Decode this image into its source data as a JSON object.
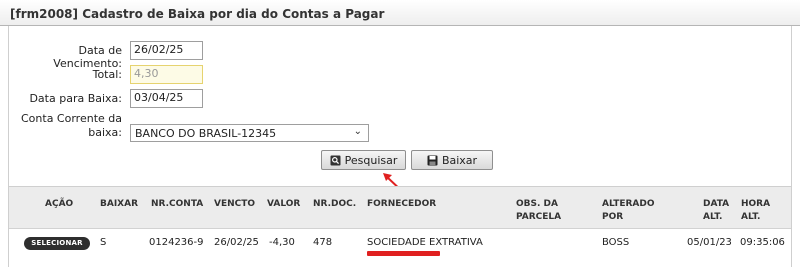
{
  "window": {
    "title": "[frm2008] Cadastro de Baixa por dia do Contas a Pagar"
  },
  "form": {
    "vencimento_label": "Data de Vencimento:",
    "vencimento_value": "26/02/25",
    "total_label": "Total:",
    "total_value": "4,30",
    "baixa_label": "Data para Baixa:",
    "baixa_value": "03/04/25",
    "conta_label_line1": "Conta Corrente da",
    "conta_label_line2": "baixa:",
    "conta_value": "BANCO DO BRASIL-12345"
  },
  "toolbar": {
    "pesquisar_label": "Pesquisar",
    "baixar_label": "Baixar",
    "pesquisar_icon": "search-icon",
    "baixar_icon": "floppy-disk-icon"
  },
  "table": {
    "headers": {
      "acao": "AÇÃO",
      "baixar": "BAIXAR",
      "nr_conta": "NR.CONTA",
      "vencto": "VENCTO",
      "valor": "VALOR",
      "nr_doc": "NR.DOC.",
      "fornecedor": "FORNECEDOR",
      "obs_1": "OBS. DA",
      "obs_2": "PARCELA",
      "alterado_1": "ALTERADO",
      "alterado_2": "POR",
      "data_1": "DATA",
      "data_2": "ALT.",
      "hora_1": "HORA",
      "hora_2": "ALT."
    },
    "rows": [
      {
        "action_label": "SELECIONAR",
        "baixar": "S",
        "nr_conta": "0124236-9",
        "vencto": "26/02/25",
        "valor": "-4,30",
        "nr_doc": "478",
        "fornecedor": "SOCIEDADE EXTRATIVA",
        "obs": "",
        "alterado": "BOSS",
        "data_alt": "05/01/23",
        "hora_alt": "09:35:06"
      }
    ]
  },
  "colors": {
    "annotation": "#e02020",
    "button_dark": "#2e2e2e",
    "readonly_bg": "#fdfbe6"
  }
}
